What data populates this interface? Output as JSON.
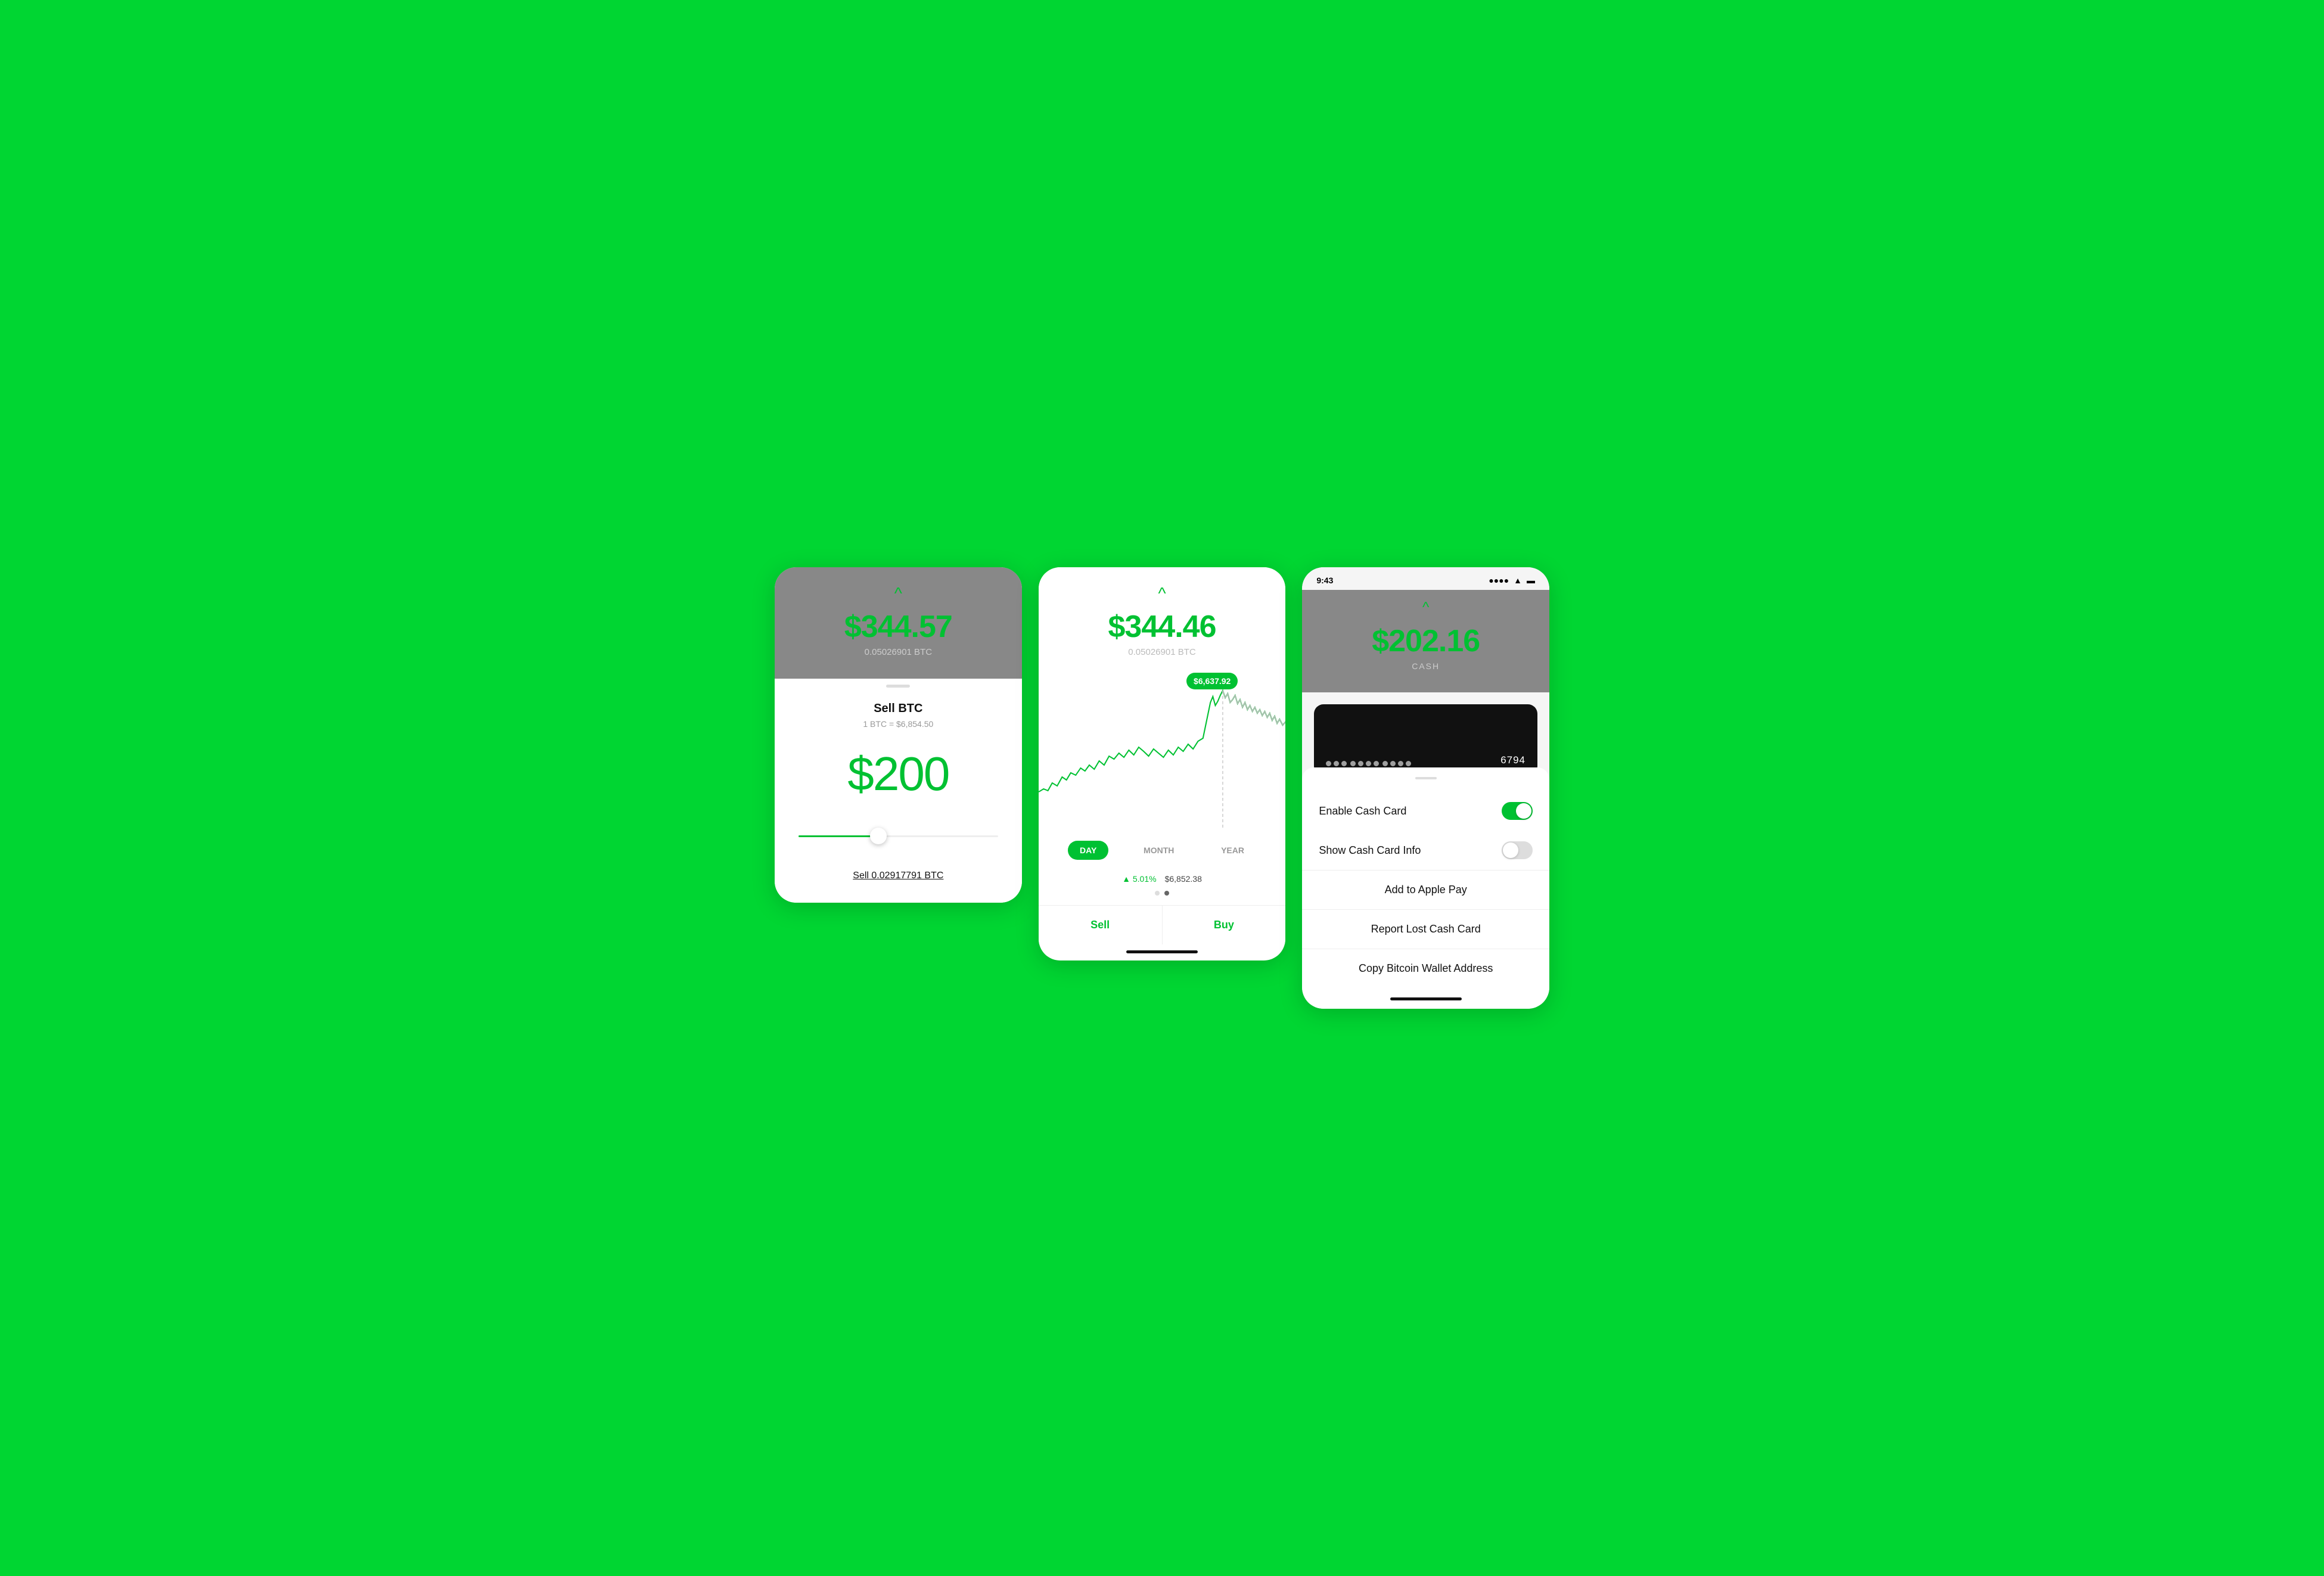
{
  "screen1": {
    "chevron": "^",
    "price": "$344.57",
    "btcAmount": "0.05026901 BTC",
    "dragHandle": "",
    "title": "Sell BTC",
    "rate": "1 BTC = $6,854.50",
    "amount": "$200",
    "sliderLabel": "Sell 0.02917791 BTC"
  },
  "screen2": {
    "chevron": "^",
    "price": "$344.46",
    "btcAmount": "0.05026901 BTC",
    "tooltip": "$6,637.92",
    "timeButtons": [
      "DAY",
      "MONTH",
      "YEAR"
    ],
    "activeTime": "DAY",
    "gain": "▲ 5.01%",
    "gainPrice": "$6,852.38",
    "sellLabel": "Sell",
    "buyLabel": "Buy"
  },
  "screen3": {
    "statusBar": {
      "time": "9:43",
      "signal": "●●●●",
      "wifi": "WiFi",
      "battery": "🔋"
    },
    "chevron": "^",
    "cashAmount": "$202.16",
    "cashLabel": "CASH",
    "cardDots1": "●●●",
    "cardDots2": "●●●●",
    "cardDots3": "●●●●",
    "cardLast4": "6794",
    "settings": [
      {
        "label": "Enable Cash Card",
        "toggle": true,
        "active": true
      },
      {
        "label": "Show Cash Card Info",
        "toggle": true,
        "active": false
      }
    ],
    "menuItems": [
      "Add to Apple Pay",
      "Report Lost Cash Card",
      "Copy Bitcoin Wallet Address"
    ]
  }
}
